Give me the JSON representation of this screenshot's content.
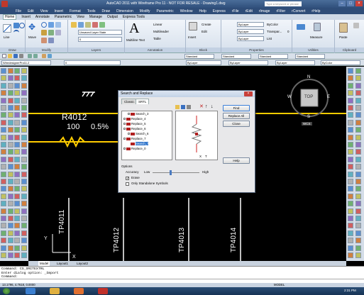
{
  "window": {
    "title": "AutoCAD 2011 with Wireframe Pro 11 - NOT FOR RESALE - Drawing1.dwg",
    "search_placeholder": "Type a keyword or phrase"
  },
  "menu": [
    "File",
    "Edit",
    "View",
    "Insert",
    "Format",
    "Tools",
    "Draw",
    "Dimension",
    "Modify",
    "Parametric",
    "Window",
    "Help",
    "Express",
    "rFile",
    "rEdit",
    "rImage",
    "rFilter",
    "rConvert",
    "rHelp"
  ],
  "ribbon_tabs": [
    "Home",
    "Insert",
    "Annotate",
    "Parametric",
    "View",
    "Manage",
    "Output",
    "Express Tools"
  ],
  "ribbon": {
    "draw_panel": "Draw",
    "modify_panel": "Modify",
    "layers_panel": "Layers",
    "annotation_panel": "Annotation",
    "block_panel": "Block",
    "properties_panel": "Properties",
    "utilities_panel": "Utilities",
    "clipboard_panel": "Clipboard",
    "line_label": "Line",
    "move_label": "Move",
    "multiline_text": "Multiline Text",
    "insert_label": "Insert",
    "measure_label": "Measure",
    "paste_label": "Paste",
    "layer_state": "Unsaved Layer State",
    "linear": "Linear",
    "multileader": "Multileader",
    "table": "Table",
    "create": "Create",
    "edit": "Edit",
    "bylayer": "ByLayer",
    "bycolor": "ByColor",
    "list": "List",
    "transparency": "Transpar...",
    "transparency_value": "0"
  },
  "toolbar": {
    "workspace": "WiredesignerPro11.2",
    "layer_combo": "0",
    "style1": "Standard",
    "style2": "Standard",
    "style3": "Standard",
    "style4": "Standard",
    "bylayer1": "ByLayer",
    "bylayer2": "ByLayer",
    "bylayer3": "ByLayer",
    "bycolor": "ByColor"
  },
  "canvas": {
    "component_ref": "R4012",
    "component_value": "100",
    "component_tol": "0.5%",
    "labels": [
      "TP4011",
      "TP4012",
      "TP4013",
      "TP4014"
    ],
    "viewcube": {
      "top": "TOP",
      "n": "N",
      "s": "S",
      "e": "E",
      "w": "W",
      "wcs": "WCS"
    }
  },
  "dialog": {
    "title": "Search and Replace",
    "tabs": [
      "Classic",
      "SRTL"
    ],
    "tree_items": [
      "Search_3",
      "Replace_4",
      "Replace_5",
      "Replace_6",
      "Search_6",
      "Replace_7",
      "Search_7",
      "Replace_0"
    ],
    "buttons": {
      "find": "Find",
      "replace_all": "Replace All",
      "close": "Close",
      "help": "Help"
    },
    "options_label": "Options",
    "accuracy_label": "Accuracy",
    "low_label": "Low",
    "high_label": "High",
    "erase_label": "Erase",
    "standalone_label": "Only Standalone Symbols",
    "x_symbol": "X",
    "t_symbol": "T"
  },
  "layout_tabs": [
    "Model",
    "Layout1",
    "Layout2"
  ],
  "command": {
    "line1": "Command: CS_SRITEXTRL",
    "line2": "Enter dialog option: _Import",
    "line3": "Command:",
    "input": ""
  },
  "status": {
    "coords": "13.1796, 4.7618, 0.0000",
    "model_label": "MODEL",
    "time": "2:31 PM"
  }
}
